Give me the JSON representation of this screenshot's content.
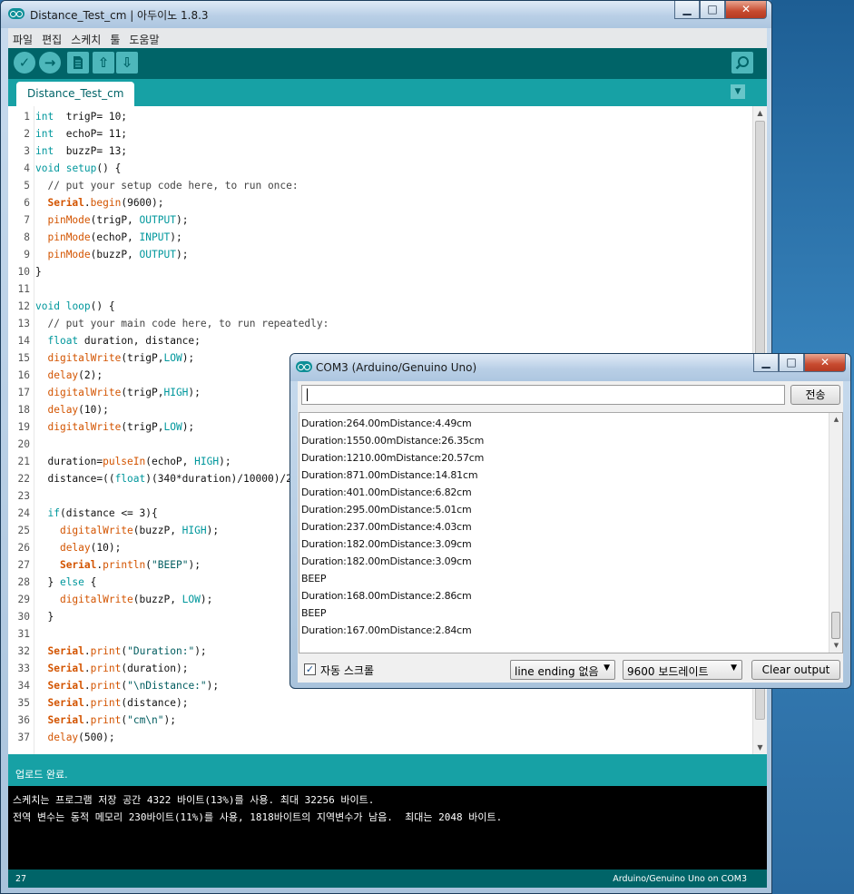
{
  "ide": {
    "window_title": "Distance_Test_cm | 아두이노 1.8.3",
    "window_controls": {
      "minimize": "▁",
      "maximize": "□",
      "close": "✕"
    },
    "menu": [
      "파일",
      "편집",
      "스케치",
      "툴",
      "도움말"
    ],
    "tab": "Distance_Test_cm",
    "code": [
      {
        "n": "1",
        "segs": [
          [
            "kw",
            "int"
          ],
          [
            "",
            "  trigP= 10;"
          ]
        ]
      },
      {
        "n": "2",
        "segs": [
          [
            "kw",
            "int"
          ],
          [
            "",
            "  echoP= 11;"
          ]
        ]
      },
      {
        "n": "3",
        "segs": [
          [
            "kw",
            "int"
          ],
          [
            "",
            "  buzzP= 13;"
          ]
        ]
      },
      {
        "n": "4",
        "segs": [
          [
            "kw",
            "void"
          ],
          [
            "",
            " "
          ],
          [
            "kw",
            "setup"
          ],
          [
            "",
            "() {"
          ]
        ]
      },
      {
        "n": "5",
        "segs": [
          [
            "cm",
            "  // put your setup code here, to run once:"
          ]
        ]
      },
      {
        "n": "6",
        "segs": [
          [
            "",
            "  "
          ],
          [
            "ser",
            "Serial"
          ],
          [
            "",
            "."
          ],
          [
            "fn",
            "begin"
          ],
          [
            "",
            "(9600);"
          ]
        ]
      },
      {
        "n": "7",
        "segs": [
          [
            "",
            "  "
          ],
          [
            "fn",
            "pinMode"
          ],
          [
            "",
            "(trigP, "
          ],
          [
            "cst",
            "OUTPUT"
          ],
          [
            "",
            ");"
          ]
        ]
      },
      {
        "n": "8",
        "segs": [
          [
            "",
            "  "
          ],
          [
            "fn",
            "pinMode"
          ],
          [
            "",
            "(echoP, "
          ],
          [
            "cst",
            "INPUT"
          ],
          [
            "",
            ");"
          ]
        ]
      },
      {
        "n": "9",
        "segs": [
          [
            "",
            "  "
          ],
          [
            "fn",
            "pinMode"
          ],
          [
            "",
            "(buzzP, "
          ],
          [
            "cst",
            "OUTPUT"
          ],
          [
            "",
            ");"
          ]
        ]
      },
      {
        "n": "10",
        "segs": [
          [
            "",
            "}"
          ]
        ]
      },
      {
        "n": "11",
        "segs": []
      },
      {
        "n": "12",
        "segs": [
          [
            "kw",
            "void"
          ],
          [
            "",
            " "
          ],
          [
            "kw",
            "loop"
          ],
          [
            "",
            "() {"
          ]
        ]
      },
      {
        "n": "13",
        "segs": [
          [
            "cm",
            "  // put your main code here, to run repeatedly:"
          ]
        ]
      },
      {
        "n": "14",
        "segs": [
          [
            "",
            "  "
          ],
          [
            "kw",
            "float"
          ],
          [
            "",
            " duration, distance;"
          ]
        ]
      },
      {
        "n": "15",
        "segs": [
          [
            "",
            "  "
          ],
          [
            "fn",
            "digitalWrite"
          ],
          [
            "",
            "(trigP,"
          ],
          [
            "cst",
            "LOW"
          ],
          [
            "",
            ");"
          ]
        ]
      },
      {
        "n": "16",
        "segs": [
          [
            "",
            "  "
          ],
          [
            "fn",
            "delay"
          ],
          [
            "",
            "(2);"
          ]
        ]
      },
      {
        "n": "17",
        "segs": [
          [
            "",
            "  "
          ],
          [
            "fn",
            "digitalWrite"
          ],
          [
            "",
            "(trigP,"
          ],
          [
            "cst",
            "HIGH"
          ],
          [
            "",
            ");"
          ]
        ]
      },
      {
        "n": "18",
        "segs": [
          [
            "",
            "  "
          ],
          [
            "fn",
            "delay"
          ],
          [
            "",
            "(10);"
          ]
        ]
      },
      {
        "n": "19",
        "segs": [
          [
            "",
            "  "
          ],
          [
            "fn",
            "digitalWrite"
          ],
          [
            "",
            "(trigP,"
          ],
          [
            "cst",
            "LOW"
          ],
          [
            "",
            ");"
          ]
        ]
      },
      {
        "n": "20",
        "segs": []
      },
      {
        "n": "21",
        "segs": [
          [
            "",
            "  duration="
          ],
          [
            "fn",
            "pulseIn"
          ],
          [
            "",
            "(echoP, "
          ],
          [
            "cst",
            "HIGH"
          ],
          [
            "",
            ");"
          ]
        ]
      },
      {
        "n": "22",
        "segs": [
          [
            "",
            "  distance=(("
          ],
          [
            "kw",
            "float"
          ],
          [
            "",
            ")(340*duration)/10000)/2;"
          ]
        ]
      },
      {
        "n": "23",
        "segs": []
      },
      {
        "n": "24",
        "segs": [
          [
            "",
            "  "
          ],
          [
            "kw",
            "if"
          ],
          [
            "",
            "(distance <= 3){"
          ]
        ]
      },
      {
        "n": "25",
        "segs": [
          [
            "",
            "    "
          ],
          [
            "fn",
            "digitalWrite"
          ],
          [
            "",
            "(buzzP, "
          ],
          [
            "cst",
            "HIGH"
          ],
          [
            "",
            ");"
          ]
        ]
      },
      {
        "n": "26",
        "segs": [
          [
            "",
            "    "
          ],
          [
            "fn",
            "delay"
          ],
          [
            "",
            "(10);"
          ]
        ]
      },
      {
        "n": "27",
        "segs": [
          [
            "",
            "    "
          ],
          [
            "ser",
            "Serial"
          ],
          [
            "",
            "."
          ],
          [
            "fn",
            "println"
          ],
          [
            "",
            "("
          ],
          [
            "str",
            "\"BEEP\""
          ],
          [
            "",
            ");"
          ]
        ]
      },
      {
        "n": "28",
        "segs": [
          [
            "",
            "  } "
          ],
          [
            "kw",
            "else"
          ],
          [
            "",
            " {"
          ]
        ]
      },
      {
        "n": "29",
        "segs": [
          [
            "",
            "    "
          ],
          [
            "fn",
            "digitalWrite"
          ],
          [
            "",
            "(buzzP, "
          ],
          [
            "cst",
            "LOW"
          ],
          [
            "",
            ");"
          ]
        ]
      },
      {
        "n": "30",
        "segs": [
          [
            "",
            "  }"
          ]
        ]
      },
      {
        "n": "31",
        "segs": []
      },
      {
        "n": "32",
        "segs": [
          [
            "",
            "  "
          ],
          [
            "ser",
            "Serial"
          ],
          [
            "",
            "."
          ],
          [
            "fn",
            "print"
          ],
          [
            "",
            "("
          ],
          [
            "str",
            "\"Duration:\""
          ],
          [
            "",
            ");"
          ]
        ]
      },
      {
        "n": "33",
        "segs": [
          [
            "",
            "  "
          ],
          [
            "ser",
            "Serial"
          ],
          [
            "",
            "."
          ],
          [
            "fn",
            "print"
          ],
          [
            "",
            "(duration);"
          ]
        ]
      },
      {
        "n": "34",
        "segs": [
          [
            "",
            "  "
          ],
          [
            "ser",
            "Serial"
          ],
          [
            "",
            "."
          ],
          [
            "fn",
            "print"
          ],
          [
            "",
            "("
          ],
          [
            "str",
            "\"\\nDistance:\""
          ],
          [
            "",
            ");"
          ]
        ]
      },
      {
        "n": "35",
        "segs": [
          [
            "",
            "  "
          ],
          [
            "ser",
            "Serial"
          ],
          [
            "",
            "."
          ],
          [
            "fn",
            "print"
          ],
          [
            "",
            "(distance);"
          ]
        ]
      },
      {
        "n": "36",
        "segs": [
          [
            "",
            "  "
          ],
          [
            "ser",
            "Serial"
          ],
          [
            "",
            "."
          ],
          [
            "fn",
            "print"
          ],
          [
            "",
            "("
          ],
          [
            "str",
            "\"cm\\n\""
          ],
          [
            "",
            ");"
          ]
        ]
      },
      {
        "n": "37",
        "segs": [
          [
            "",
            "  "
          ],
          [
            "fn",
            "delay"
          ],
          [
            "",
            "(500);"
          ]
        ]
      }
    ],
    "status_message": "업로드 완료.",
    "console_lines": [
      "스케치는 프로그램 저장 공간 4322 바이트(13%)를 사용. 최대 32256 바이트.",
      "전역 변수는 동적 메모리 230바이트(11%)를 사용, 1818바이트의 지역변수가 남음.  최대는 2048 바이트."
    ],
    "footer_line": "27",
    "footer_board": "Arduino/Genuino Uno on COM3"
  },
  "serial_monitor": {
    "title": "COM3 (Arduino/Genuino Uno)",
    "send_label": "전송",
    "output": [
      "Duration:264.00mDistance:4.49cm",
      "Duration:1550.00mDistance:26.35cm",
      "Duration:1210.00mDistance:20.57cm",
      "Duration:871.00mDistance:14.81cm",
      "Duration:401.00mDistance:6.82cm",
      "Duration:295.00mDistance:5.01cm",
      "Duration:237.00mDistance:4.03cm",
      "Duration:182.00mDistance:3.09cm",
      "Duration:182.00mDistance:3.09cm",
      "BEEP",
      "Duration:168.00mDistance:2.86cm",
      "BEEP",
      "Duration:167.00mDistance:2.84cm"
    ],
    "autoscroll_label": "자동 스크롤",
    "autoscroll_checked": true,
    "line_ending": "line ending 없음",
    "baud": "9600 보드레이트",
    "clear_label": "Clear output"
  }
}
